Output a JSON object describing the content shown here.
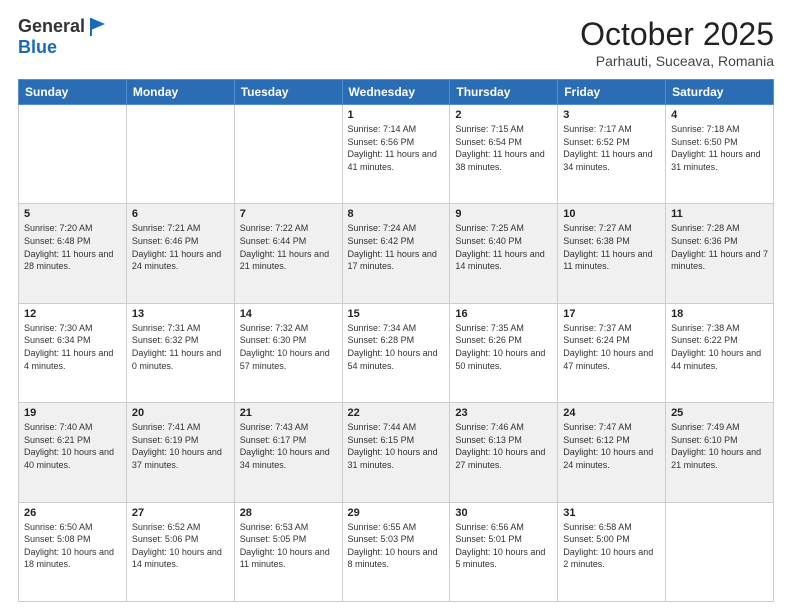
{
  "logo": {
    "general": "General",
    "blue": "Blue"
  },
  "title": "October 2025",
  "location": "Parhauti, Suceava, Romania",
  "days": [
    "Sunday",
    "Monday",
    "Tuesday",
    "Wednesday",
    "Thursday",
    "Friday",
    "Saturday"
  ],
  "weeks": [
    [
      {
        "date": "",
        "info": ""
      },
      {
        "date": "",
        "info": ""
      },
      {
        "date": "",
        "info": ""
      },
      {
        "date": "1",
        "info": "Sunrise: 7:14 AM\nSunset: 6:56 PM\nDaylight: 11 hours and 41 minutes."
      },
      {
        "date": "2",
        "info": "Sunrise: 7:15 AM\nSunset: 6:54 PM\nDaylight: 11 hours and 38 minutes."
      },
      {
        "date": "3",
        "info": "Sunrise: 7:17 AM\nSunset: 6:52 PM\nDaylight: 11 hours and 34 minutes."
      },
      {
        "date": "4",
        "info": "Sunrise: 7:18 AM\nSunset: 6:50 PM\nDaylight: 11 hours and 31 minutes."
      }
    ],
    [
      {
        "date": "5",
        "info": "Sunrise: 7:20 AM\nSunset: 6:48 PM\nDaylight: 11 hours and 28 minutes."
      },
      {
        "date": "6",
        "info": "Sunrise: 7:21 AM\nSunset: 6:46 PM\nDaylight: 11 hours and 24 minutes."
      },
      {
        "date": "7",
        "info": "Sunrise: 7:22 AM\nSunset: 6:44 PM\nDaylight: 11 hours and 21 minutes."
      },
      {
        "date": "8",
        "info": "Sunrise: 7:24 AM\nSunset: 6:42 PM\nDaylight: 11 hours and 17 minutes."
      },
      {
        "date": "9",
        "info": "Sunrise: 7:25 AM\nSunset: 6:40 PM\nDaylight: 11 hours and 14 minutes."
      },
      {
        "date": "10",
        "info": "Sunrise: 7:27 AM\nSunset: 6:38 PM\nDaylight: 11 hours and 11 minutes."
      },
      {
        "date": "11",
        "info": "Sunrise: 7:28 AM\nSunset: 6:36 PM\nDaylight: 11 hours and 7 minutes."
      }
    ],
    [
      {
        "date": "12",
        "info": "Sunrise: 7:30 AM\nSunset: 6:34 PM\nDaylight: 11 hours and 4 minutes."
      },
      {
        "date": "13",
        "info": "Sunrise: 7:31 AM\nSunset: 6:32 PM\nDaylight: 11 hours and 0 minutes."
      },
      {
        "date": "14",
        "info": "Sunrise: 7:32 AM\nSunset: 6:30 PM\nDaylight: 10 hours and 57 minutes."
      },
      {
        "date": "15",
        "info": "Sunrise: 7:34 AM\nSunset: 6:28 PM\nDaylight: 10 hours and 54 minutes."
      },
      {
        "date": "16",
        "info": "Sunrise: 7:35 AM\nSunset: 6:26 PM\nDaylight: 10 hours and 50 minutes."
      },
      {
        "date": "17",
        "info": "Sunrise: 7:37 AM\nSunset: 6:24 PM\nDaylight: 10 hours and 47 minutes."
      },
      {
        "date": "18",
        "info": "Sunrise: 7:38 AM\nSunset: 6:22 PM\nDaylight: 10 hours and 44 minutes."
      }
    ],
    [
      {
        "date": "19",
        "info": "Sunrise: 7:40 AM\nSunset: 6:21 PM\nDaylight: 10 hours and 40 minutes."
      },
      {
        "date": "20",
        "info": "Sunrise: 7:41 AM\nSunset: 6:19 PM\nDaylight: 10 hours and 37 minutes."
      },
      {
        "date": "21",
        "info": "Sunrise: 7:43 AM\nSunset: 6:17 PM\nDaylight: 10 hours and 34 minutes."
      },
      {
        "date": "22",
        "info": "Sunrise: 7:44 AM\nSunset: 6:15 PM\nDaylight: 10 hours and 31 minutes."
      },
      {
        "date": "23",
        "info": "Sunrise: 7:46 AM\nSunset: 6:13 PM\nDaylight: 10 hours and 27 minutes."
      },
      {
        "date": "24",
        "info": "Sunrise: 7:47 AM\nSunset: 6:12 PM\nDaylight: 10 hours and 24 minutes."
      },
      {
        "date": "25",
        "info": "Sunrise: 7:49 AM\nSunset: 6:10 PM\nDaylight: 10 hours and 21 minutes."
      }
    ],
    [
      {
        "date": "26",
        "info": "Sunrise: 6:50 AM\nSunset: 5:08 PM\nDaylight: 10 hours and 18 minutes."
      },
      {
        "date": "27",
        "info": "Sunrise: 6:52 AM\nSunset: 5:06 PM\nDaylight: 10 hours and 14 minutes."
      },
      {
        "date": "28",
        "info": "Sunrise: 6:53 AM\nSunset: 5:05 PM\nDaylight: 10 hours and 11 minutes."
      },
      {
        "date": "29",
        "info": "Sunrise: 6:55 AM\nSunset: 5:03 PM\nDaylight: 10 hours and 8 minutes."
      },
      {
        "date": "30",
        "info": "Sunrise: 6:56 AM\nSunset: 5:01 PM\nDaylight: 10 hours and 5 minutes."
      },
      {
        "date": "31",
        "info": "Sunrise: 6:58 AM\nSunset: 5:00 PM\nDaylight: 10 hours and 2 minutes."
      },
      {
        "date": "",
        "info": ""
      }
    ]
  ]
}
